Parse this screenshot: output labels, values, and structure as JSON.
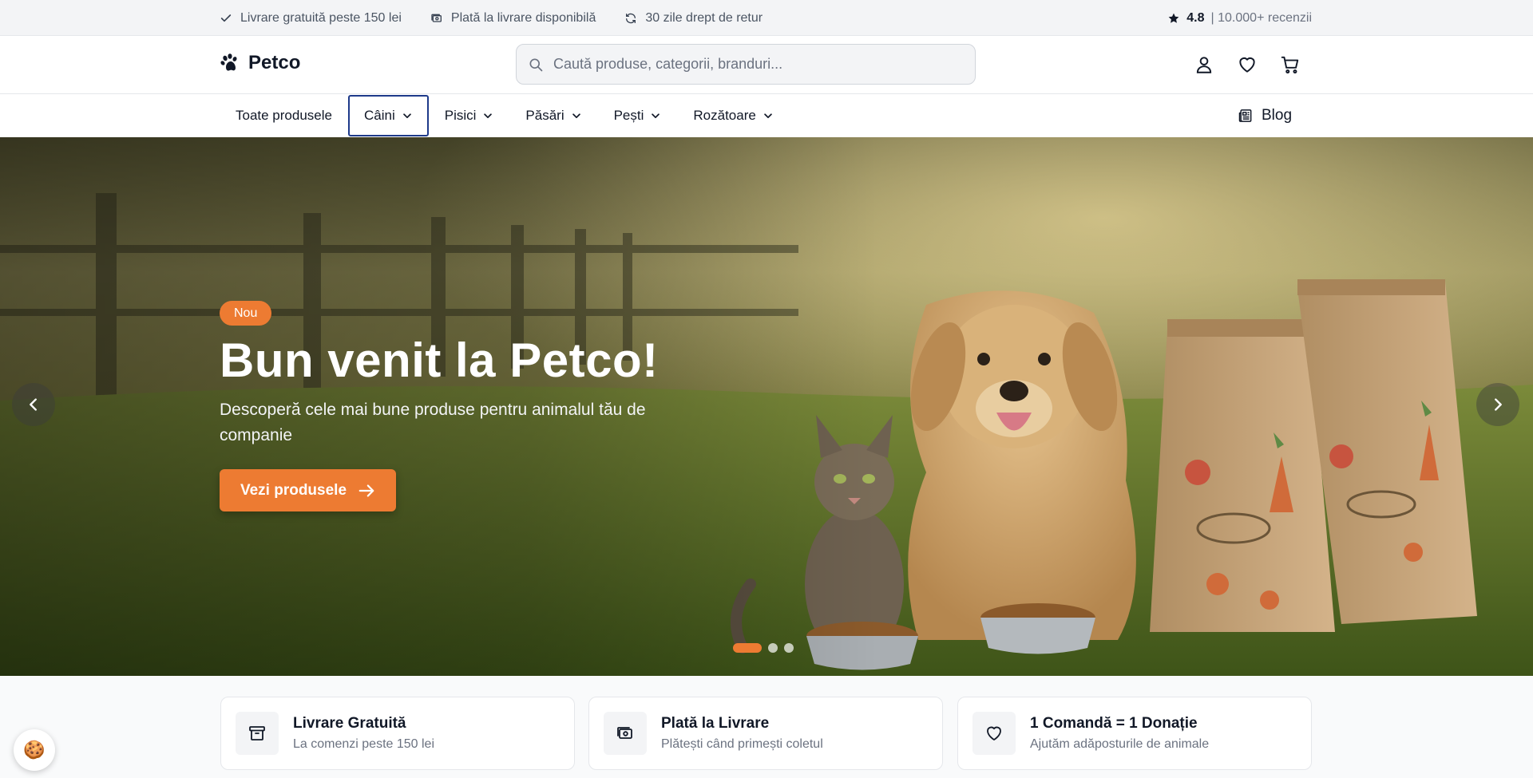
{
  "topbar": {
    "items": [
      {
        "icon": "check-icon",
        "label": "Livrare gratuită peste 150 lei"
      },
      {
        "icon": "cash-icon",
        "label": "Plată la livrare disponibilă"
      },
      {
        "icon": "refresh-icon",
        "label": "30 zile drept de retur"
      }
    ],
    "rating": {
      "icon": "star-icon",
      "value": "4.8",
      "reviews": "| 10.000+ recenzii"
    }
  },
  "header": {
    "logo": "Petco",
    "search_placeholder": "Caută produse, categorii, branduri...",
    "icons": [
      "user-icon",
      "heart-icon",
      "cart-icon"
    ]
  },
  "nav": {
    "items": [
      {
        "label": "Toate produsele",
        "dropdown": false
      },
      {
        "label": "Câini",
        "dropdown": true,
        "active": true
      },
      {
        "label": "Pisici",
        "dropdown": true
      },
      {
        "label": "Păsări",
        "dropdown": true
      },
      {
        "label": "Pești",
        "dropdown": true
      },
      {
        "label": "Rozătoare",
        "dropdown": true
      }
    ],
    "blog": "Blog"
  },
  "hero": {
    "badge": "Nou",
    "title": "Bun venit la Petco!",
    "subtitle": "Descoperă cele mai bune produse pentru animalul tău de companie",
    "cta": "Vezi produsele",
    "slides_total": 3,
    "slide_active": 1
  },
  "features": [
    {
      "icon": "archive-box-icon",
      "title": "Livrare Gratuită",
      "desc": "La comenzi peste 150 lei"
    },
    {
      "icon": "cash-icon",
      "title": "Plată la Livrare",
      "desc": "Plătești când primești coletul"
    },
    {
      "icon": "heart-icon",
      "title": "1 Comandă = 1 Donație",
      "desc": "Ajutăm adăposturile de animale"
    }
  ],
  "colors": {
    "accent": "#ed7b32",
    "active_outline": "#1e3a8a",
    "text": "#111827",
    "muted": "#6b7280"
  }
}
